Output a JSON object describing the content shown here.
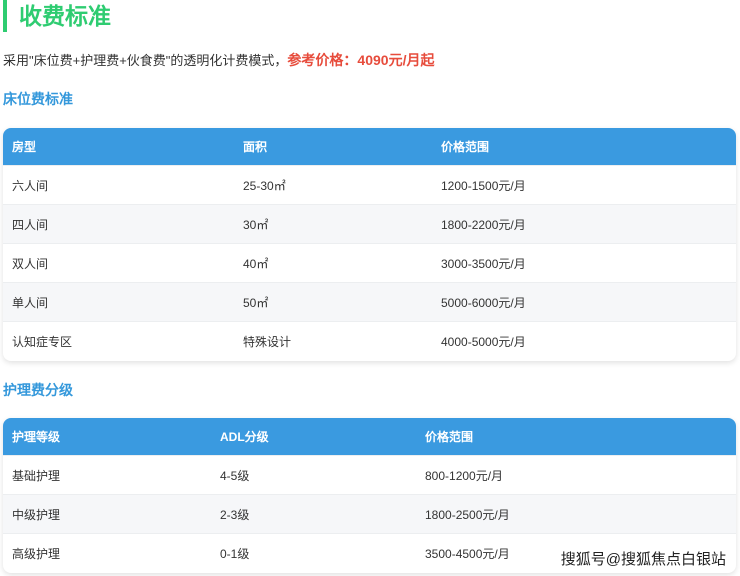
{
  "title": "收费标准",
  "intro": {
    "text": "采用\"床位费+护理费+伙食费\"的透明化计费模式，",
    "highlight": "参考价格：4090元/月起"
  },
  "bed": {
    "heading": "床位费标准",
    "headers": [
      "房型",
      "面积",
      "价格范围"
    ],
    "rows": [
      [
        "六人间",
        "25-30㎡",
        "1200-1500元/月"
      ],
      [
        "四人间",
        "30㎡",
        "1800-2200元/月"
      ],
      [
        "双人间",
        "40㎡",
        "3000-3500元/月"
      ],
      [
        "单人间",
        "50㎡",
        "5000-6000元/月"
      ],
      [
        "认知症专区",
        "特殊设计",
        "4000-5000元/月"
      ]
    ]
  },
  "care": {
    "heading": "护理费分级",
    "headers": [
      "护理等级",
      "ADL分级",
      "价格范围"
    ],
    "rows": [
      [
        "基础护理",
        "4-5级",
        "800-1200元/月"
      ],
      [
        "中级护理",
        "2-3级",
        "1800-2500元/月"
      ],
      [
        "高级护理",
        "0-1级",
        "3500-4500元/月"
      ]
    ]
  },
  "watermark": "搜狐号@搜狐焦点白银站"
}
